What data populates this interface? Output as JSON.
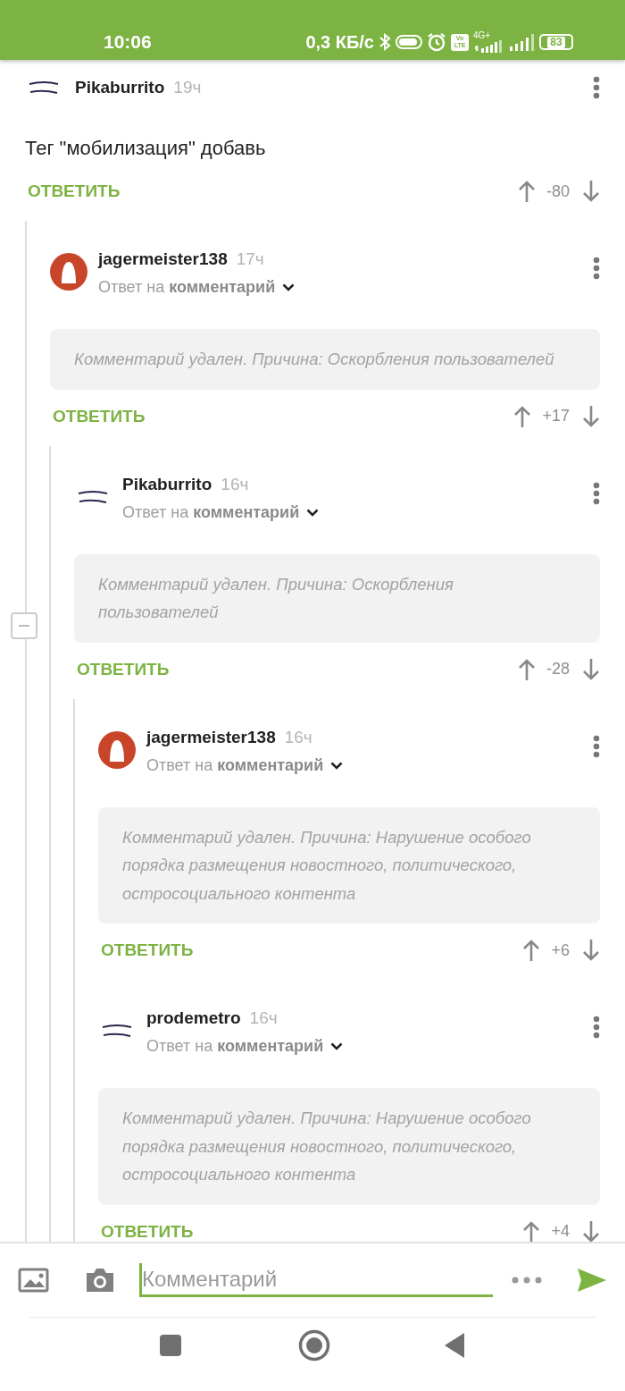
{
  "status_bar": {
    "time": "10:06",
    "speed": "0,3 КБ/с",
    "volte_top": "Vo",
    "volte_bottom": "LTE",
    "network": "4G+",
    "battery": "83"
  },
  "comments": [
    {
      "author": "Pikaburrito",
      "time": "19ч",
      "text": "Тег \"мобилизация\" добавь",
      "deleted": false,
      "reply_label": "ОТВЕТИТЬ",
      "score": "-80",
      "thread_expanded": true,
      "children": [
        {
          "author": "jagermeister138",
          "time": "17ч",
          "reply_prefix": "Ответ на",
          "reply_target": "комментарий",
          "text": "Комментарий удален. Причина: Оскорбления пользователей",
          "deleted": true,
          "reply_label": "ОТВЕТИТЬ",
          "score": "+17",
          "children": [
            {
              "author": "Pikaburrito",
              "time": "16ч",
              "reply_prefix": "Ответ на",
              "reply_target": "комментарий",
              "text": "Комментарий удален. Причина: Оскорбления пользователей",
              "deleted": true,
              "reply_label": "ОТВЕТИТЬ",
              "score": "-28",
              "children": [
                {
                  "author": "jagermeister138",
                  "time": "16ч",
                  "reply_prefix": "Ответ на",
                  "reply_target": "комментарий",
                  "text": "Комментарий удален. Причина: Нарушение особого порядка размещения новостного, политического, остросоциального контента",
                  "deleted": true,
                  "reply_label": "ОТВЕТИТЬ",
                  "score": "+6"
                },
                {
                  "author": "prodemetro",
                  "time": "16ч",
                  "reply_prefix": "Ответ на",
                  "reply_target": "комментарий",
                  "text": "Комментарий удален. Причина: Нарушение особого порядка размещения новостного, политического, остросоциального контента",
                  "deleted": true,
                  "reply_label": "ОТВЕТИТЬ",
                  "score": "+4"
                }
              ]
            }
          ]
        }
      ]
    }
  ],
  "comment_input": {
    "placeholder": "Комментарий"
  }
}
